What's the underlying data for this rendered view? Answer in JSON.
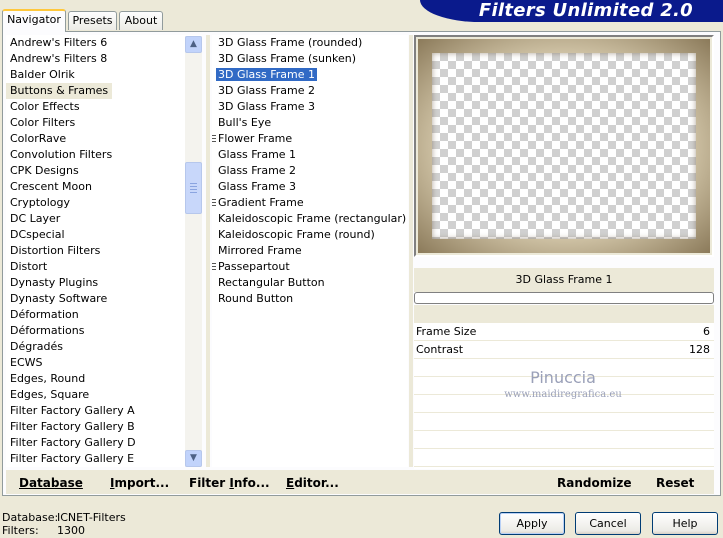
{
  "tabs": [
    {
      "label": "Navigator",
      "active": true
    },
    {
      "label": "Presets",
      "active": false
    },
    {
      "label": "About",
      "active": false
    }
  ],
  "banner": {
    "title": "Filters Unlimited 2.0"
  },
  "categories": [
    "Andrew's Filters 6",
    "Andrew's Filters 8",
    "Balder Olrik",
    "Buttons & Frames",
    "Color Effects",
    "Color Filters",
    "ColorRave",
    "Convolution Filters",
    "CPK Designs",
    "Crescent Moon",
    "Cryptology",
    "DC Layer",
    "DCspecial",
    "Distortion Filters",
    "Distort",
    "Dynasty Plugins",
    "Dynasty Software",
    "Déformation",
    "Déformations",
    "Dégradés",
    "ECWS",
    "Edges, Round",
    "Edges, Square",
    "Filter Factory Gallery A",
    "Filter Factory Gallery B",
    "Filter Factory Gallery D",
    "Filter Factory Gallery E"
  ],
  "selected_category": "Buttons & Frames",
  "filters": [
    {
      "label": "3D Glass Frame (rounded)",
      "group": false
    },
    {
      "label": "3D Glass Frame (sunken)",
      "group": false
    },
    {
      "label": "3D Glass Frame 1",
      "group": false
    },
    {
      "label": "3D Glass Frame 2",
      "group": false
    },
    {
      "label": "3D Glass Frame 3",
      "group": false
    },
    {
      "label": "Bull's Eye",
      "group": false
    },
    {
      "label": "Flower Frame",
      "group": true
    },
    {
      "label": "Glass Frame 1",
      "group": false
    },
    {
      "label": "Glass Frame 2",
      "group": false
    },
    {
      "label": "Glass Frame 3",
      "group": false
    },
    {
      "label": "Gradient Frame",
      "group": true
    },
    {
      "label": "Kaleidoscopic Frame (rectangular)",
      "group": false
    },
    {
      "label": "Kaleidoscopic Frame (round)",
      "group": false
    },
    {
      "label": "Mirrored Frame",
      "group": false
    },
    {
      "label": "Passepartout",
      "group": true
    },
    {
      "label": "Rectangular Button",
      "group": false
    },
    {
      "label": "Round Button",
      "group": false
    }
  ],
  "selected_filter": "3D Glass Frame 1",
  "preview": {
    "filter_name": "3D Glass Frame 1",
    "progress": 0
  },
  "parameters": [
    {
      "name": "Frame Size",
      "value": "6"
    },
    {
      "name": "Contrast",
      "value": "128"
    }
  ],
  "watermark": {
    "title": "Pinuccia",
    "url": "www.maidiregrafica.eu"
  },
  "bottom_bar": {
    "database": "Database",
    "import_u": "I",
    "import_rest": "mport...",
    "info_pre": "Filter ",
    "info_u": "I",
    "info_rest": "nfo...",
    "editor_u": "E",
    "editor_rest": "ditor...",
    "randomize": "Randomize",
    "reset": "Reset"
  },
  "status": {
    "database_label": "Database:",
    "database_value": "ICNET-Filters",
    "filters_label": "Filters:",
    "filters_value": "1300"
  },
  "dialog": {
    "apply": "Apply",
    "cancel": "Cancel",
    "help": "Help"
  },
  "colors": {
    "selection": "#316ac5",
    "banner": "#0a1a8c",
    "face": "#ece9d8"
  }
}
